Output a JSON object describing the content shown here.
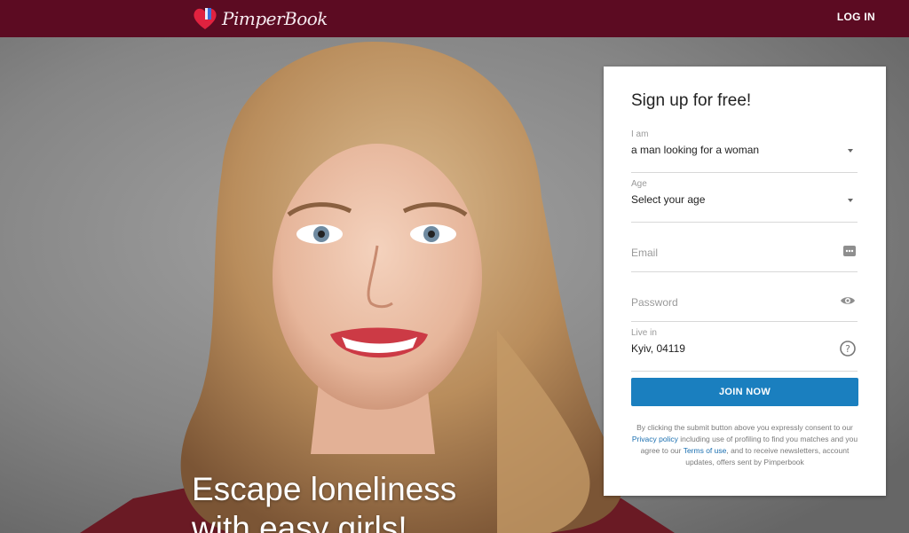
{
  "header": {
    "logo_text": "PimperBook",
    "login_label": "LOG IN"
  },
  "hero": {
    "tagline_line1": "Escape loneliness",
    "tagline_line2": "with easy girls!"
  },
  "signup": {
    "title": "Sign up for free!",
    "iam_label": "I am",
    "iam_value": "a man looking for a woman",
    "age_label": "Age",
    "age_value": "Select your age",
    "email_placeholder": "Email",
    "password_placeholder": "Password",
    "livein_label": "Live in",
    "livein_value": "Kyiv, 04119",
    "join_label": "JOIN NOW",
    "legal": {
      "part1": "By clicking the submit button above you expressly consent to our ",
      "privacy_link": "Privacy policy",
      "part2": " including use of profiling to find you matches and you agree to our ",
      "terms_link": "Terms of use",
      "part3": ", and to receive newsletters, account updates, offers sent by Pimperbook"
    }
  },
  "colors": {
    "header_bg": "#5c0b22",
    "button_bg": "#1a7fbf",
    "link": "#1a6fb0",
    "logo_heart": "#e0223f"
  },
  "icons": [
    "heart-logo-icon",
    "chevron-down-icon",
    "email-dots-icon",
    "eye-icon",
    "help-circle-icon"
  ]
}
